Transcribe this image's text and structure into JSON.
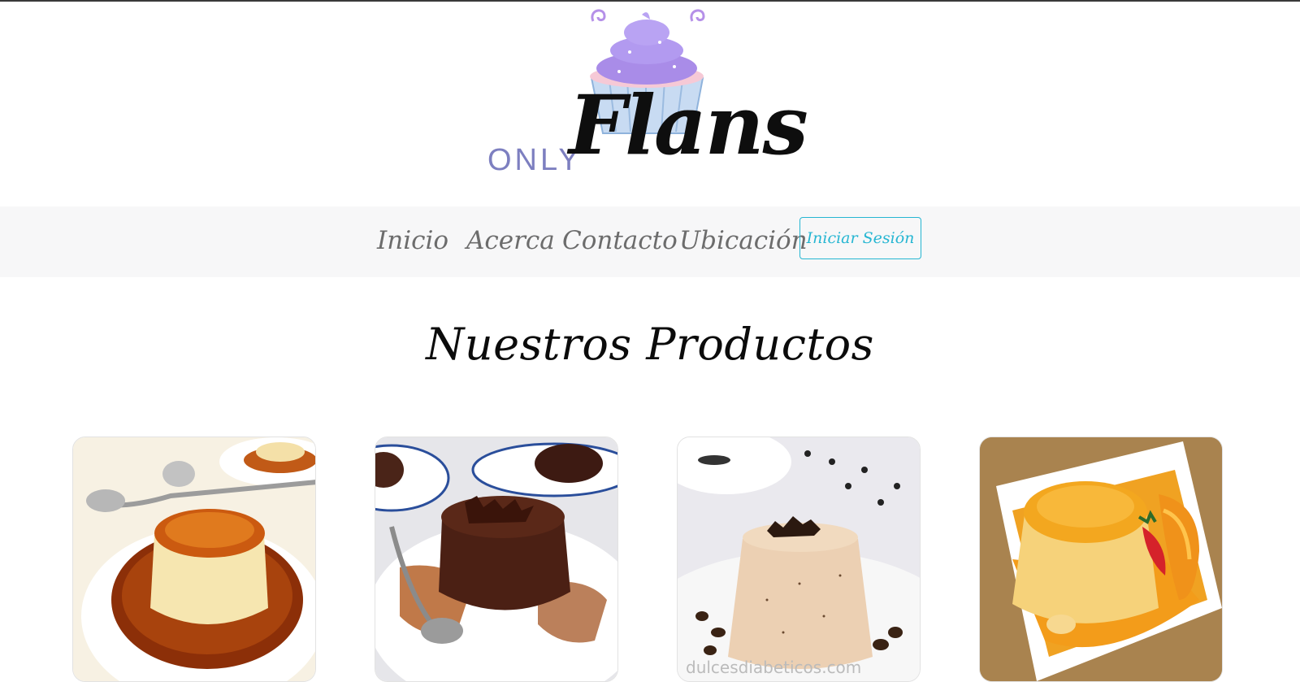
{
  "brand": {
    "logo_prefix": "ONLY",
    "logo_name": "Flans"
  },
  "nav": {
    "items": [
      {
        "label": "Inicio"
      },
      {
        "label": "Acerca"
      },
      {
        "label": "Contacto"
      },
      {
        "label": "Ubicación"
      }
    ],
    "login_label": "Iniciar Sesión"
  },
  "products": {
    "title": "Nuestros Productos",
    "items": [
      {
        "image": "caramel-flan-image"
      },
      {
        "image": "chocolate-flan-image"
      },
      {
        "image": "coffee-flan-image"
      },
      {
        "image": "orange-flan-image"
      }
    ],
    "watermark": "dulcesdiabeticos.com"
  },
  "colors": {
    "accent": "#26b6d2",
    "nav_bg": "#f7f7f8",
    "logo_purple": "#a98ce8",
    "logo_text_purple": "#7d7fc0"
  }
}
